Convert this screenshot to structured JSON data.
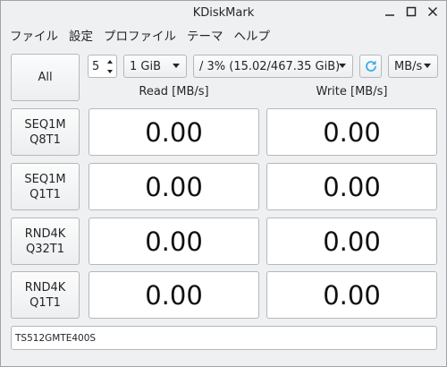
{
  "window": {
    "title": "KDiskMark"
  },
  "menu": [
    "ファイル",
    "設定",
    "プロファイル",
    "テーマ",
    "ヘルプ"
  ],
  "toolbar": {
    "all_label": "All",
    "runs_value": "5",
    "size_value": "1 GiB",
    "target_value": "/ 3% (15.02/467.35 GiB)",
    "unit_value": "MB/s",
    "refresh_icon_color": "#3daee9"
  },
  "headers": {
    "read": "Read [MB/s]",
    "write": "Write [MB/s]"
  },
  "tests": [
    {
      "line1": "SEQ1M",
      "line2": "Q8T1",
      "read": "0.00",
      "write": "0.00"
    },
    {
      "line1": "SEQ1M",
      "line2": "Q1T1",
      "read": "0.00",
      "write": "0.00"
    },
    {
      "line1": "RND4K",
      "line2": "Q32T1",
      "read": "0.00",
      "write": "0.00"
    },
    {
      "line1": "RND4K",
      "line2": "Q1T1",
      "read": "0.00",
      "write": "0.00"
    }
  ],
  "status": {
    "device": "TS512GMTE400S"
  }
}
